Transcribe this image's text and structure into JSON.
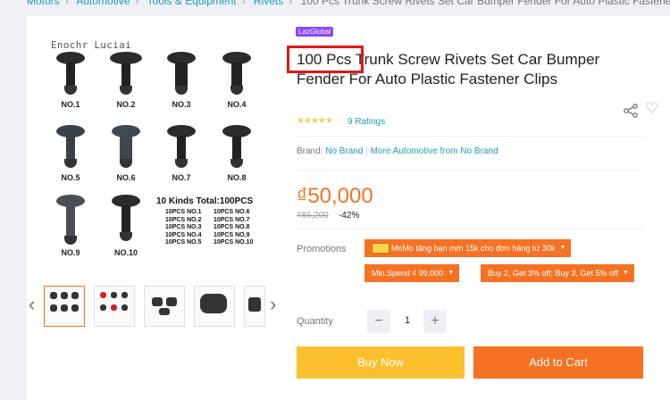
{
  "breadcrumb": [
    "Motors",
    "Automotive",
    "Tools & Equipment",
    "Rivets",
    "100 Pcs Trunk Screw Rivets Set Car Bumper Fender For Auto Plastic Fastener Clips"
  ],
  "gallery": {
    "watermark": "Enochr Luciai",
    "labels": [
      "NO.1",
      "NO.2",
      "NO.3",
      "NO.4",
      "NO.5",
      "NO.6",
      "NO.7",
      "NO.8",
      "NO.9",
      "NO.10"
    ],
    "kinds_text": "10 Kinds   Total:100PCS",
    "list_left": [
      "10PCS NO.1",
      "10PCS NO.2",
      "10PCS NO.3",
      "10PCS NO.4",
      "10PCS NO.5"
    ],
    "list_right": [
      "10PCS NO.6",
      "10PCS NO.7",
      "10PCS NO.8",
      "10PCS NO.9",
      "10PCS NO.10"
    ]
  },
  "thumb_prev_icon": "chevron-left-icon",
  "thumb_next_icon": "chevron-right-icon",
  "badge": "LazGlobal",
  "title": "100 Pcs Trunk Screw Rivets Set Car Bumper Fender For Auto Plastic Fastener Clips",
  "rating": {
    "stars": 5,
    "text": "9 Ratings"
  },
  "brand": {
    "label": "Brand:",
    "value": "No Brand",
    "more": "More Automotive from No Brand"
  },
  "price": {
    "current": "₫50,000",
    "original": "₫86,200",
    "discount": "-42%"
  },
  "promotions": {
    "label": "Promotions",
    "tags": [
      "MoMo tặng bạn mới 15k cho đơn hàng từ 30k",
      "Min.Spend ₫ 99,000",
      "Buy 2, Get 3% off; Buy 3, Get 5% off"
    ]
  },
  "quantity": {
    "label": "Quantity",
    "value": "1",
    "minus": "−",
    "plus": "+"
  },
  "buttons": {
    "buy_now": "Buy Now",
    "add_to_cart": "Add to Cart"
  },
  "colors": {
    "accent": "#f57224",
    "buy": "#fbc02d",
    "link": "#1a9cb7",
    "highlight": "#e01818"
  }
}
